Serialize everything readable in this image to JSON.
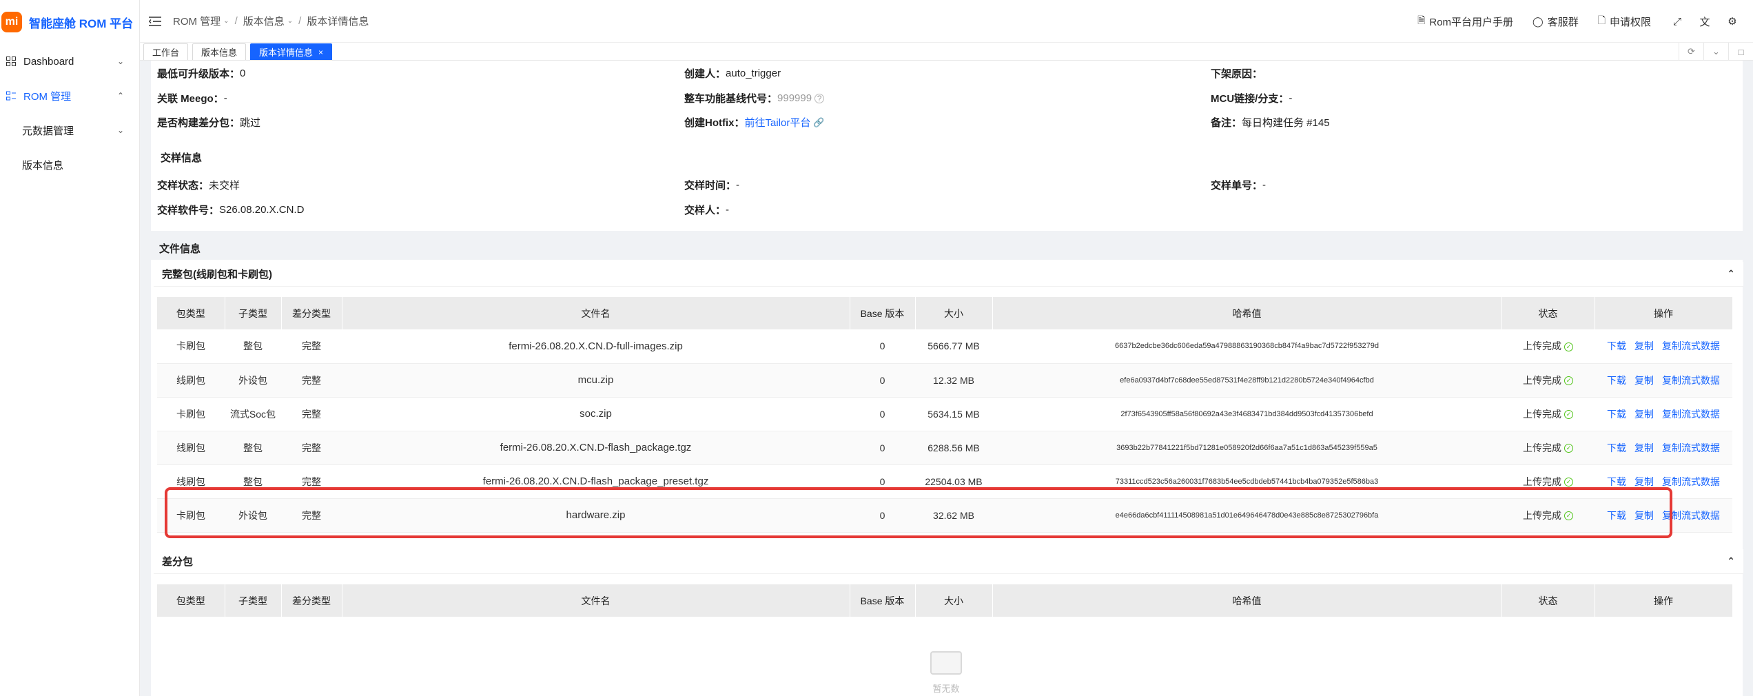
{
  "sidebar": {
    "logo_mark": "mi",
    "logo_text": "智能座舱 ROM 平台",
    "items": [
      {
        "label": "Dashboard",
        "icon": "grid-icon"
      },
      {
        "label": "ROM 管理",
        "icon": "rom-icon"
      },
      {
        "label": "元数据管理"
      },
      {
        "label": "版本信息"
      }
    ]
  },
  "header": {
    "breadcrumb": [
      "ROM 管理",
      "版本信息",
      "版本详情信息"
    ],
    "links": {
      "manual": "Rom平台用户手册",
      "support": "客服群",
      "permission": "申请权限"
    }
  },
  "tabs": [
    {
      "label": "工作台"
    },
    {
      "label": "版本信息"
    },
    {
      "label": "版本详情信息",
      "close": "×"
    }
  ],
  "info": {
    "min_upgrade_label": "最低可升级版本：",
    "min_upgrade_value": "0",
    "creator_label": "创建人：",
    "creator_value": "auto_trigger",
    "offline_reason_label": "下架原因：",
    "offline_reason_value": "-",
    "meego_label": "关联 Meego：",
    "meego_value": "-",
    "baseline_label": "整车功能基线代号：",
    "baseline_value": "999999",
    "mcu_label": "MCU链接/分支：",
    "mcu_value": "-",
    "diff_label": "是否构建差分包：",
    "diff_value": "跳过",
    "hotfix_label": "创建Hotfix：",
    "hotfix_value": "前往Tailor平台",
    "remark_label": "备注：",
    "remark_value": "每日构建任务 #145"
  },
  "sample": {
    "title": "交样信息",
    "status_label": "交样状态：",
    "status_value": "未交样",
    "time_label": "交样时间：",
    "time_value": "-",
    "order_label": "交样单号：",
    "order_value": "-",
    "software_label": "交样软件号：",
    "software_value": "S26.08.20.X.CN.D",
    "person_label": "交样人：",
    "person_value": "-"
  },
  "files": {
    "title": "文件信息",
    "full_title": "完整包(线刷包和卡刷包)",
    "diff_title": "差分包",
    "columns": [
      "包类型",
      "子类型",
      "差分类型",
      "文件名",
      "Base 版本",
      "大小",
      "哈希值",
      "状态",
      "操作"
    ],
    "ops": [
      "下载",
      "复制",
      "复制流式数据"
    ],
    "rows": [
      {
        "type": "卡刷包",
        "sub": "整包",
        "diff": "完整",
        "file": "fermi-26.08.20.X.CN.D-full-images.zip",
        "base": "0",
        "size": "5666.77 MB",
        "hash": "6637b2edcbe36dc606eda59a47988863190368cb847f4a9bac7d5722f953279d",
        "status": "上传完成"
      },
      {
        "type": "线刷包",
        "sub": "外设包",
        "diff": "完整",
        "file": "mcu.zip",
        "base": "0",
        "size": "12.32 MB",
        "hash": "efe6a0937d4bf7c68dee55ed87531f4e28ff9b121d2280b5724e340f4964cfbd",
        "status": "上传完成"
      },
      {
        "type": "卡刷包",
        "sub": "流式Soc包",
        "diff": "完整",
        "file": "soc.zip",
        "base": "0",
        "size": "5634.15 MB",
        "hash": "2f73f6543905ff58a56f80692a43e3f4683471bd384dd9503fcd41357306befd",
        "status": "上传完成"
      },
      {
        "type": "线刷包",
        "sub": "整包",
        "diff": "完整",
        "file": "fermi-26.08.20.X.CN.D-flash_package.tgz",
        "base": "0",
        "size": "6288.56 MB",
        "hash": "3693b22b77841221f5bd71281e058920f2d66f6aa7a51c1d863a545239f559a5",
        "status": "上传完成"
      },
      {
        "type": "线刷包",
        "sub": "整包",
        "diff": "完整",
        "file": "fermi-26.08.20.X.CN.D-flash_package_preset.tgz",
        "base": "0",
        "size": "22504.03 MB",
        "hash": "73311ccd523c56a260031f7683b54ee5cdbdeb57441bcb4ba079352e5f586ba3",
        "status": "上传完成"
      },
      {
        "type": "卡刷包",
        "sub": "外设包",
        "diff": "完整",
        "file": "hardware.zip",
        "base": "0",
        "size": "32.62 MB",
        "hash": "e4e66da6cbf411114508981a51d01e649646478d0e43e885c8e8725302796bfa",
        "status": "上传完成"
      }
    ],
    "empty_text": "暂无数据"
  }
}
